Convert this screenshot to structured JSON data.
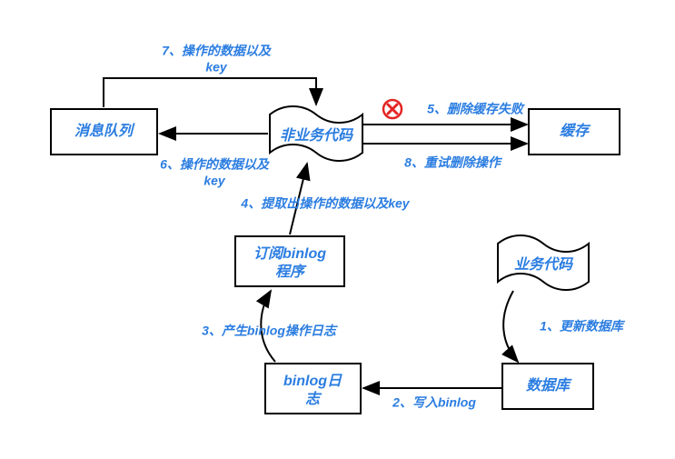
{
  "nodes": {
    "msg_queue": "消息队列",
    "non_biz_code": "非业务代码",
    "cache": "缓存",
    "sub_binlog_l1": "订阅binlog",
    "sub_binlog_l2": "程序",
    "binlog_log_l1": "binlog日",
    "binlog_log_l2": "志",
    "biz_code": "业务代码",
    "database": "数据库"
  },
  "edges": {
    "e1": "1、更新数据库",
    "e2": "2、写入binlog",
    "e3": "3、产生binlog操作日志",
    "e4": "4、提取出操作的数据以及key",
    "e5": "5、删除缓存失败",
    "e6_l1": "6、操作的数据以及",
    "e6_l2": "key",
    "e7_l1": "7、操作的数据以及",
    "e7_l2": "key",
    "e8": "8、重试删除操作"
  },
  "icons": {
    "fail": "fail-x-icon"
  }
}
